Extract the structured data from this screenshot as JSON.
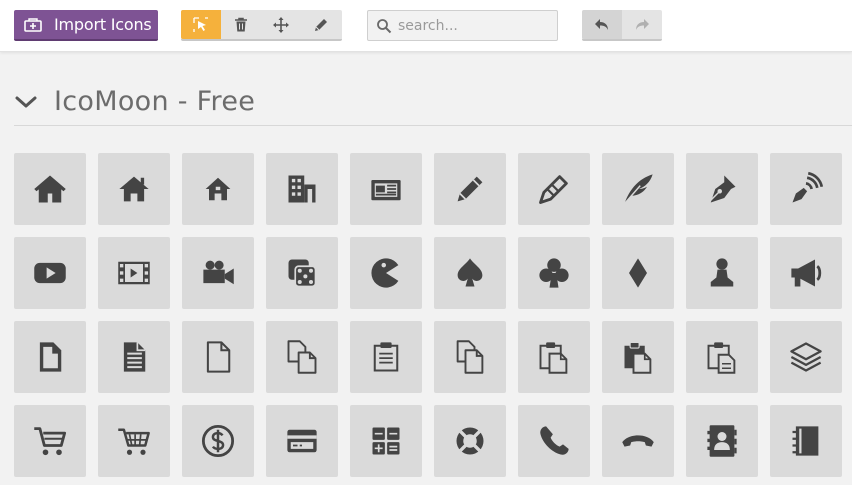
{
  "toolbar": {
    "import_label": "Import Icons",
    "tools": [
      "select-icon",
      "trash-icon",
      "move-icon",
      "pencil-icon"
    ],
    "active_tool": "select-icon",
    "search_placeholder": "search...",
    "history": [
      "undo-icon",
      "redo-icon"
    ]
  },
  "set": {
    "title": "IcoMoon - Free",
    "expanded": true
  },
  "icons": [
    [
      "home-icon",
      "home2-icon",
      "home3-icon",
      "office-icon",
      "newspaper-icon",
      "pencil-icon",
      "pencil2-icon",
      "quill-icon",
      "pen-icon",
      "blog-icon"
    ],
    [
      "youtube-icon",
      "film-icon",
      "video-camera-icon",
      "dice-icon",
      "pacman-icon",
      "spades-icon",
      "clubs-icon",
      "diamonds-icon",
      "pawn-icon",
      "bullhorn-icon"
    ],
    [
      "file-icon",
      "file-text-icon",
      "file-empty-icon",
      "files-empty-icon",
      "file-text2-icon",
      "copy-icon",
      "paste-icon",
      "paste2-icon",
      "paste3-icon",
      "stack-icon"
    ],
    [
      "cart-icon",
      "cart2-icon",
      "coin-dollar-icon",
      "credit-card-icon",
      "calculator-icon",
      "lifebuoy-icon",
      "phone-icon",
      "phone-hang-up-icon",
      "address-book-icon",
      "notebook-icon"
    ]
  ],
  "colors": {
    "accent": "#7e5394",
    "active_tool": "#f5b13c",
    "icon": "#444444",
    "tile": "#dadada"
  }
}
